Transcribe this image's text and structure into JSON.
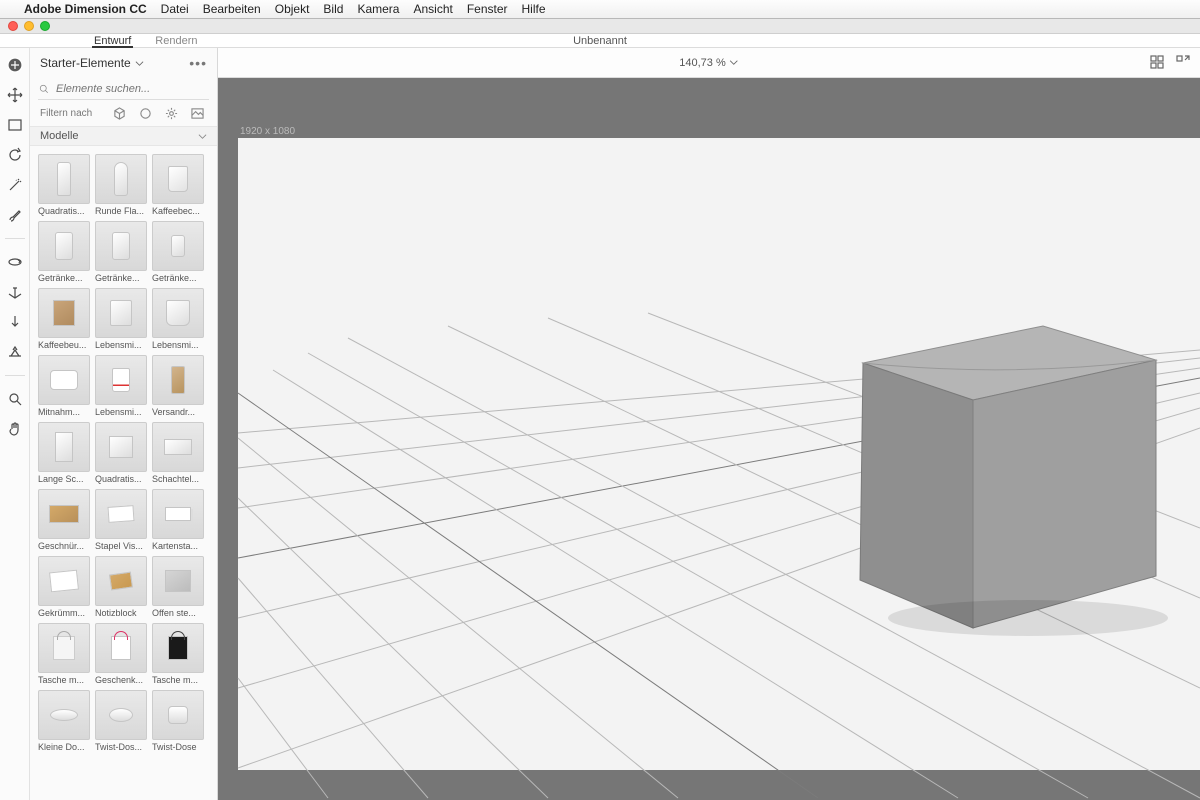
{
  "menubar": {
    "app": "Adobe Dimension CC",
    "items": [
      "Datei",
      "Bearbeiten",
      "Objekt",
      "Bild",
      "Kamera",
      "Ansicht",
      "Fenster",
      "Hilfe"
    ]
  },
  "tabs": {
    "design": "Entwurf",
    "render": "Rendern"
  },
  "document_title": "Unbenannt",
  "zoom": "140,73 %",
  "canvas_dimensions": "1920 x 1080",
  "assets": {
    "panel_title": "Starter-Elemente",
    "search_placeholder": "Elemente suchen...",
    "filter_label": "Filtern nach",
    "section": "Modelle",
    "items": [
      {
        "label": "Quadratis...",
        "shape": "sh-bottle"
      },
      {
        "label": "Runde Fla...",
        "shape": "sh-bottle round"
      },
      {
        "label": "Kaffeebec...",
        "shape": "sh-cup"
      },
      {
        "label": "Getränke...",
        "shape": "sh-can"
      },
      {
        "label": "Getränke...",
        "shape": "sh-can"
      },
      {
        "label": "Getränke...",
        "shape": "sh-can small"
      },
      {
        "label": "Kaffeebeu...",
        "shape": "sh-bag"
      },
      {
        "label": "Lebensmi...",
        "shape": "sh-pouch"
      },
      {
        "label": "Lebensmi...",
        "shape": "sh-pouch2"
      },
      {
        "label": "Mitnahm...",
        "shape": "sh-takeout"
      },
      {
        "label": "Lebensmi...",
        "shape": "sh-coffee"
      },
      {
        "label": "Versandr...",
        "shape": "sh-tube"
      },
      {
        "label": "Lange Sc...",
        "shape": "sh-tallbox"
      },
      {
        "label": "Quadratis...",
        "shape": "sh-sqbox"
      },
      {
        "label": "Schachtel...",
        "shape": "sh-flatbox"
      },
      {
        "label": "Geschnür...",
        "shape": "sh-cardbox"
      },
      {
        "label": "Stapel Vis...",
        "shape": "sh-cards"
      },
      {
        "label": "Kartensta...",
        "shape": "sh-stack"
      },
      {
        "label": "Gekrümm...",
        "shape": "sh-sheet"
      },
      {
        "label": "Notizblock",
        "shape": "sh-notebk"
      },
      {
        "label": "Offen ste...",
        "shape": "sh-openbox"
      },
      {
        "label": "Tasche m...",
        "shape": "sh-bagh"
      },
      {
        "label": "Geschenk...",
        "shape": "sh-gift"
      },
      {
        "label": "Tasche m...",
        "shape": "sh-bagb"
      },
      {
        "label": "Kleine Do...",
        "shape": "sh-tin"
      },
      {
        "label": "Twist-Dos...",
        "shape": "sh-tin2"
      },
      {
        "label": "Twist-Dose",
        "shape": "sh-tin3"
      }
    ]
  },
  "tool_rail": [
    "add-icon",
    "move-icon",
    "rect-icon",
    "rotate-icon",
    "wand-icon",
    "brush-icon",
    "orbit-icon",
    "anchor-icon",
    "drop-icon",
    "horizon-icon",
    "zoom-icon",
    "hand-icon"
  ]
}
